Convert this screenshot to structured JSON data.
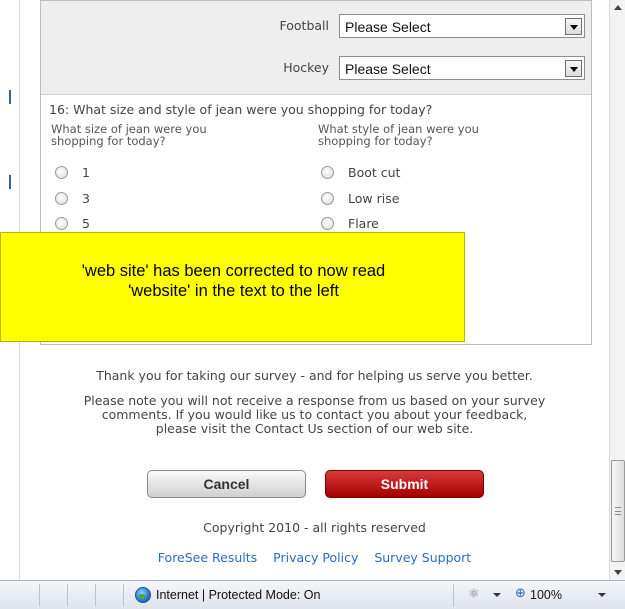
{
  "sports": [
    {
      "label": "Football",
      "value": "Please Select"
    },
    {
      "label": "Hockey",
      "value": "Please Select"
    }
  ],
  "question": {
    "title": "16: What size and style of jean were you shopping for today?",
    "size_header": "What size of jean were you shopping for today?",
    "style_header": "What style of jean were you shopping for today?",
    "sizes": [
      "1",
      "3",
      "5"
    ],
    "styles": [
      "Boot cut",
      "Low rise",
      "Flare"
    ]
  },
  "callout": {
    "line1": "'web site' has been corrected to now read",
    "line2": "'website' in the text to the left"
  },
  "thanks": "Thank you for taking our survey - and for helping us serve you better.",
  "notice": "Please note you will not receive a response from us based on your survey comments. If you would like us to contact you about your feedback, please visit the Contact Us section of our web site.",
  "buttons": {
    "cancel": "Cancel",
    "submit": "Submit"
  },
  "copyright": "Copyright 2010 - all rights reserved",
  "links": [
    "ForeSee Results",
    "Privacy Policy",
    "Survey Support"
  ],
  "statusbar": {
    "zone": "Internet | Protected Mode: On",
    "zoom": "100%"
  }
}
